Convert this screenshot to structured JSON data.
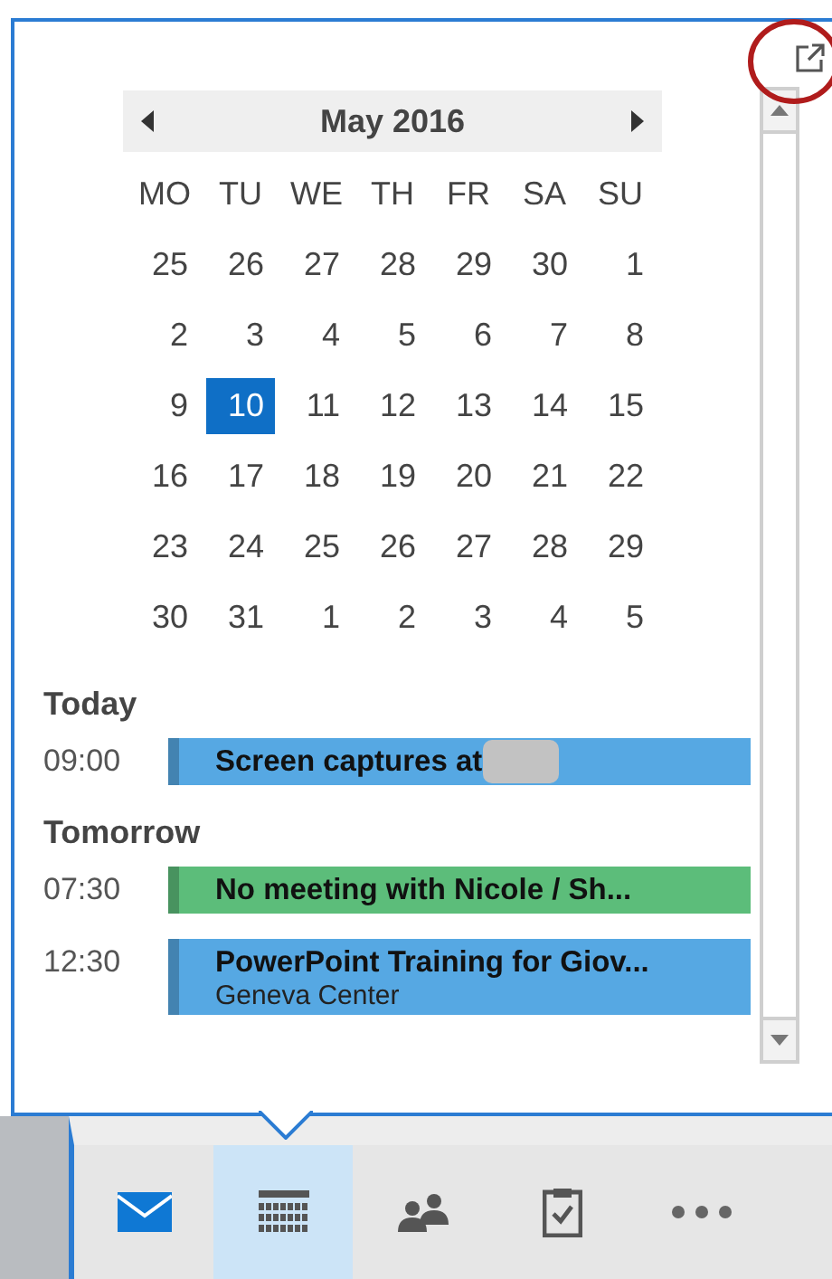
{
  "calendar": {
    "month": "May 2016",
    "weekdays": [
      "MO",
      "TU",
      "WE",
      "TH",
      "FR",
      "SA",
      "SU"
    ],
    "weeks": [
      [
        {
          "label": "25",
          "selected": false
        },
        {
          "label": "26",
          "selected": false
        },
        {
          "label": "27",
          "selected": false
        },
        {
          "label": "28",
          "selected": false
        },
        {
          "label": "29",
          "selected": false
        },
        {
          "label": "30",
          "selected": false
        },
        {
          "label": "1",
          "selected": false
        }
      ],
      [
        {
          "label": "2",
          "selected": false
        },
        {
          "label": "3",
          "selected": false
        },
        {
          "label": "4",
          "selected": false
        },
        {
          "label": "5",
          "selected": false
        },
        {
          "label": "6",
          "selected": false
        },
        {
          "label": "7",
          "selected": false
        },
        {
          "label": "8",
          "selected": false
        }
      ],
      [
        {
          "label": "9",
          "selected": false
        },
        {
          "label": "10",
          "selected": true
        },
        {
          "label": "11",
          "selected": false
        },
        {
          "label": "12",
          "selected": false
        },
        {
          "label": "13",
          "selected": false
        },
        {
          "label": "14",
          "selected": false
        },
        {
          "label": "15",
          "selected": false
        }
      ],
      [
        {
          "label": "16",
          "selected": false
        },
        {
          "label": "17",
          "selected": false
        },
        {
          "label": "18",
          "selected": false
        },
        {
          "label": "19",
          "selected": false
        },
        {
          "label": "20",
          "selected": false
        },
        {
          "label": "21",
          "selected": false
        },
        {
          "label": "22",
          "selected": false
        }
      ],
      [
        {
          "label": "23",
          "selected": false
        },
        {
          "label": "24",
          "selected": false
        },
        {
          "label": "25",
          "selected": false
        },
        {
          "label": "26",
          "selected": false
        },
        {
          "label": "27",
          "selected": false
        },
        {
          "label": "28",
          "selected": false
        },
        {
          "label": "29",
          "selected": false
        }
      ],
      [
        {
          "label": "30",
          "selected": false
        },
        {
          "label": "31",
          "selected": false
        },
        {
          "label": "1",
          "selected": false
        },
        {
          "label": "2",
          "selected": false
        },
        {
          "label": "3",
          "selected": false
        },
        {
          "label": "4",
          "selected": false
        },
        {
          "label": "5",
          "selected": false
        }
      ]
    ]
  },
  "agenda": [
    {
      "title": "Today",
      "events": [
        {
          "time": "09:00",
          "title": "Screen captures at",
          "redacted": true,
          "color": "#56a8e3"
        }
      ]
    },
    {
      "title": "Tomorrow",
      "events": [
        {
          "time": "07:30",
          "title": "No meeting with Nicole / Sh...",
          "redacted": false,
          "color": "#5cbd7a"
        },
        {
          "time": "12:30",
          "title": "PowerPoint Training for Giov...",
          "location": "Geneva Center",
          "redacted": false,
          "color": "#56a8e3"
        }
      ]
    }
  ],
  "nav": [
    {
      "kind": "mail",
      "selected": false
    },
    {
      "kind": "calendar",
      "selected": true
    },
    {
      "kind": "people",
      "selected": false
    },
    {
      "kind": "tasks",
      "selected": false
    },
    {
      "kind": "more",
      "selected": false
    }
  ]
}
